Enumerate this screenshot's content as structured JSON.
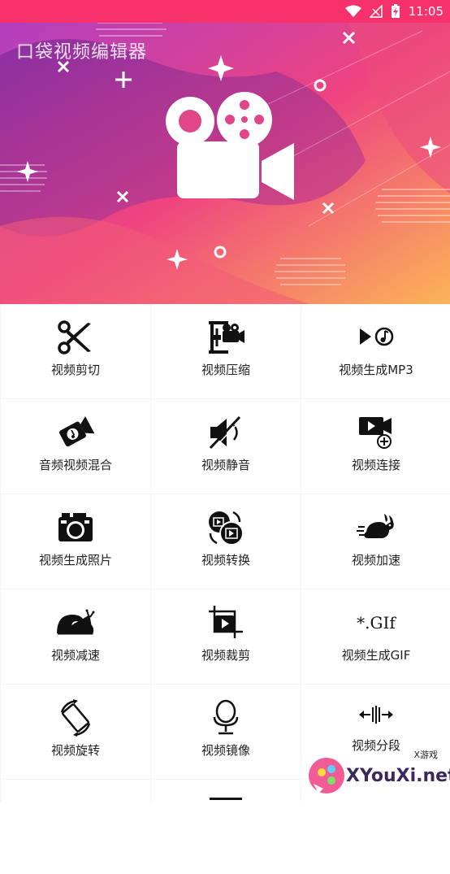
{
  "status_bar": {
    "time": "11:05",
    "bg_color": "#f7316b",
    "icons": [
      "wifi-icon",
      "signal-off-icon",
      "battery-charging-icon"
    ]
  },
  "banner": {
    "app_title": "口袋视频编辑器",
    "logo_icon": "video-camera-icon",
    "gradient_colors": [
      "#c13fb8",
      "#f0447a",
      "#f9a85a"
    ]
  },
  "tools": [
    {
      "label": "视频剪切",
      "icon": "scissors-icon"
    },
    {
      "label": "视频压缩",
      "icon": "clamp-camera-icon"
    },
    {
      "label": "视频生成MP3",
      "icon": "play-music-icon"
    },
    {
      "label": "音频视频混合",
      "icon": "audio-video-mix-icon"
    },
    {
      "label": "视频静音",
      "icon": "mute-icon"
    },
    {
      "label": "视频连接",
      "icon": "video-add-icon"
    },
    {
      "label": "视频生成照片",
      "icon": "camera-icon"
    },
    {
      "label": "视频转换",
      "icon": "convert-icon"
    },
    {
      "label": "视频加速",
      "icon": "rabbit-icon"
    },
    {
      "label": "视频减速",
      "icon": "snail-icon"
    },
    {
      "label": "视频裁剪",
      "icon": "crop-icon"
    },
    {
      "label": "视频生成GIF",
      "icon": "gif-icon",
      "icon_text": "*.GIf"
    },
    {
      "label": "视频旋转",
      "icon": "rotate-icon"
    },
    {
      "label": "视频镜像",
      "icon": "mirror-icon"
    },
    {
      "label": "视频分段",
      "icon": "split-icon"
    }
  ],
  "watermark": {
    "site": "XYouXi.net",
    "tag": "X游戏"
  }
}
